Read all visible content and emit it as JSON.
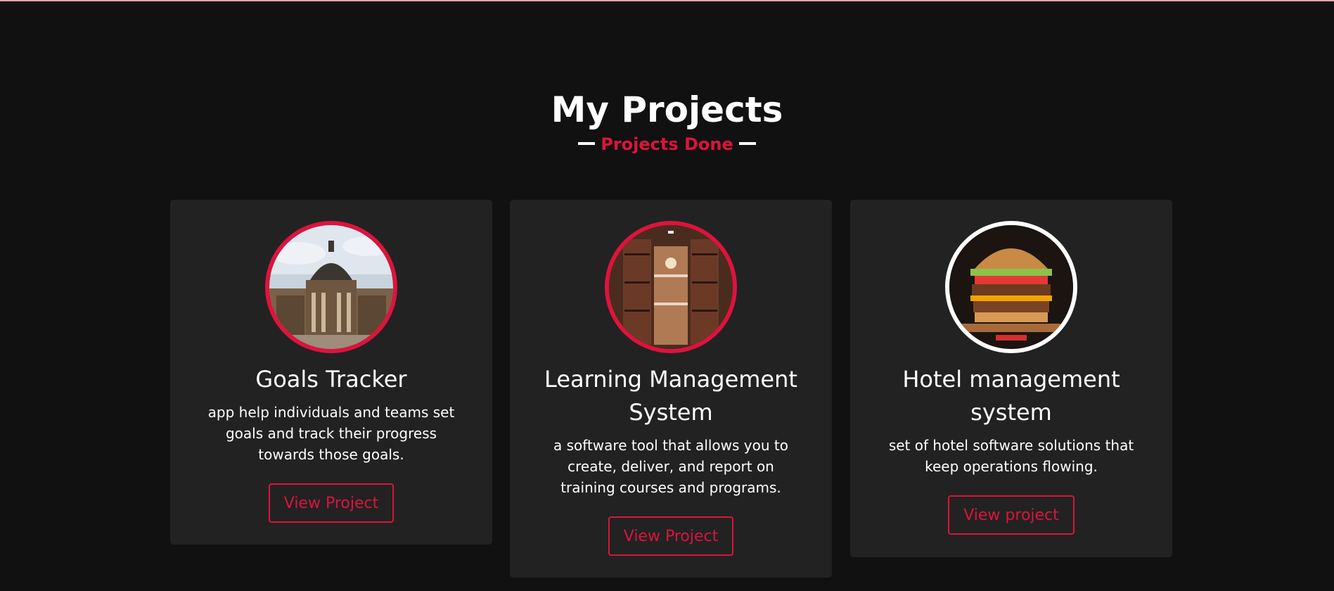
{
  "section": {
    "title": "My Projects",
    "subtitle": "Projects Done"
  },
  "colors": {
    "background": "#111111",
    "card": "#222222",
    "accent": "#dc143c",
    "text": "#ffffff"
  },
  "projects": [
    {
      "title": "Goals Tracker",
      "description": "app help individuals and teams set goals and track their progress towards those goals.",
      "button": "View Project",
      "image": "domed-building-photo"
    },
    {
      "title": "Learning Management System",
      "description": "a software tool that allows you to create, deliver, and report on training courses and programs.",
      "button": "View Project",
      "image": "library-bookshelf-photo"
    },
    {
      "title": "Hotel management system",
      "description": "set of hotel software solutions that keep operations flowing.",
      "button": "View project",
      "image": "burger-photo"
    }
  ]
}
